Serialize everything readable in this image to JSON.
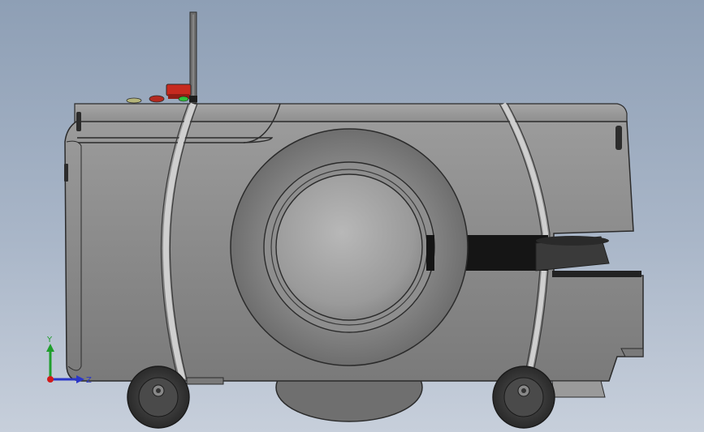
{
  "viewport": {
    "background_top": "#8e9fb5",
    "background_bottom": "#c7cfdb"
  },
  "model": {
    "body_color": "#8a8a8a",
    "edge_color": "#2b2b2b",
    "wheel_color": "#3a3a3a",
    "estop_color": "#c62a1f",
    "status_green": "#2fbf3a"
  },
  "triad": {
    "y_label": "Y",
    "z_label": "Z",
    "y_color": "#1f9e2c",
    "z_color": "#2a36c8",
    "origin_color": "#d11a1a"
  }
}
